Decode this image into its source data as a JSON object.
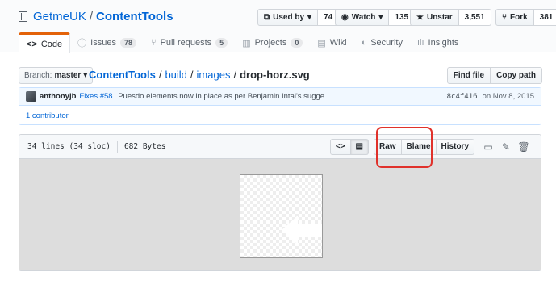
{
  "repo": {
    "owner": "GetmeUK",
    "separator": "/",
    "name": "ContentTools"
  },
  "actions": {
    "used_by": {
      "label": "Used by",
      "count": "74"
    },
    "watch": {
      "label": "Watch",
      "count": "135"
    },
    "unstar": {
      "label": "Unstar",
      "count": "3,551"
    },
    "fork": {
      "label": "Fork",
      "count": "381"
    }
  },
  "tabs": [
    {
      "label": "Code",
      "icon": "code-icon",
      "glyph": "<>"
    },
    {
      "label": "Issues",
      "icon": "issue-icon",
      "glyph": "ⓘ",
      "count": "78"
    },
    {
      "label": "Pull requests",
      "icon": "pull-request-icon",
      "glyph": "⑂",
      "count": "5"
    },
    {
      "label": "Projects",
      "icon": "project-icon",
      "glyph": "▥",
      "count": "0"
    },
    {
      "label": "Wiki",
      "icon": "wiki-icon",
      "glyph": "▤"
    },
    {
      "label": "Security",
      "icon": "shield-icon",
      "glyph": "◐"
    },
    {
      "label": "Insights",
      "icon": "graph-icon",
      "glyph": "ılı"
    }
  ],
  "branch": {
    "label": "Branch:",
    "value": "master"
  },
  "breadcrumb": {
    "root": "ContentTools",
    "sep": "/",
    "seg1": "build",
    "seg2": "images",
    "file": "drop-horz.svg"
  },
  "file_nav": {
    "find_file": "Find file",
    "copy_path": "Copy path"
  },
  "commit": {
    "author": "anthonyjb",
    "link": "Fixes #58.",
    "message": "Puesdo elements now in place as per Benjamin Intal's sugge...",
    "sha": "8c4f416",
    "date": "on Nov 8, 2015"
  },
  "contributors": "1 contributor",
  "file_info": {
    "lines": "34 lines (34 sloc)",
    "size": "682 Bytes"
  },
  "file_buttons": {
    "raw": "Raw",
    "blame": "Blame",
    "history": "History"
  },
  "colors": {
    "link": "#0366d6",
    "accent_tab": "#e36209",
    "highlight": "#e0312b"
  }
}
